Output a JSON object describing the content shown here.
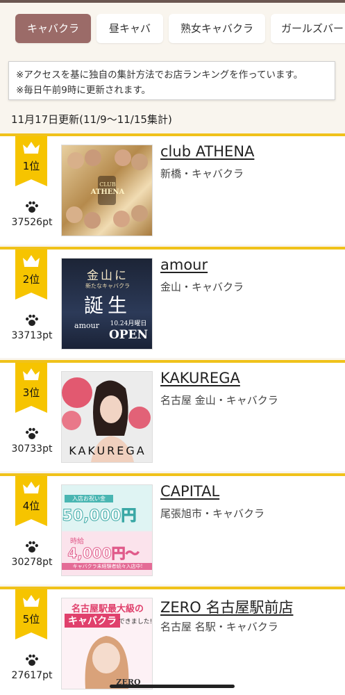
{
  "tabs": [
    {
      "label": "キャバクラ",
      "active": true
    },
    {
      "label": "昼キャバ",
      "active": false
    },
    {
      "label": "熟女キャバクラ",
      "active": false
    },
    {
      "label": "ガールズバー",
      "active": false
    }
  ],
  "notice": {
    "line1": "※アクセスを基に独自の集計方法でお店ランキングを作っています。",
    "line2": "※毎日午前9時に更新されます。"
  },
  "updated": "11月17日更新(11/9〜11/15集計)",
  "rankings": [
    {
      "rank": "1位",
      "points": "37526pt",
      "name": "club ATHENA",
      "meta": "新橋・キャバクラ",
      "image_text": [
        "CLUB",
        "ATHENA"
      ]
    },
    {
      "rank": "2位",
      "points": "33713pt",
      "name": "amour",
      "meta": "金山・キャバクラ",
      "image_text": [
        "金山に",
        "新たなキャバクラ",
        "誕生",
        "amour",
        "10.24月曜日",
        "OPEN"
      ]
    },
    {
      "rank": "3位",
      "points": "30733pt",
      "name": "KAKUREGA",
      "meta": "名古屋 金山・キャバクラ",
      "image_text": [
        "KAKUREGA"
      ]
    },
    {
      "rank": "4位",
      "points": "30278pt",
      "name": "CAPITAL",
      "meta": "尾張旭市・キャバクラ",
      "image_text": [
        "入店お祝い金",
        "50,000円",
        "時給",
        "4,000円〜",
        "キャバクラ未経験者続々入店中!"
      ]
    },
    {
      "rank": "5位",
      "points": "27617pt",
      "name": "ZERO 名古屋駅前店",
      "meta": "名古屋 名駅・キャバクラ",
      "image_text": [
        "名古屋駅最大級の",
        "キャバクラ",
        "できました!",
        "ZERO"
      ]
    }
  ],
  "colors": {
    "accent_tab": "#9b6b68",
    "rank_gold": "#f6c400",
    "card_border": "#f0c21a",
    "background": "#f9f5ee"
  },
  "icons": {
    "badge": "crown-icon",
    "points": "paw-icon"
  }
}
